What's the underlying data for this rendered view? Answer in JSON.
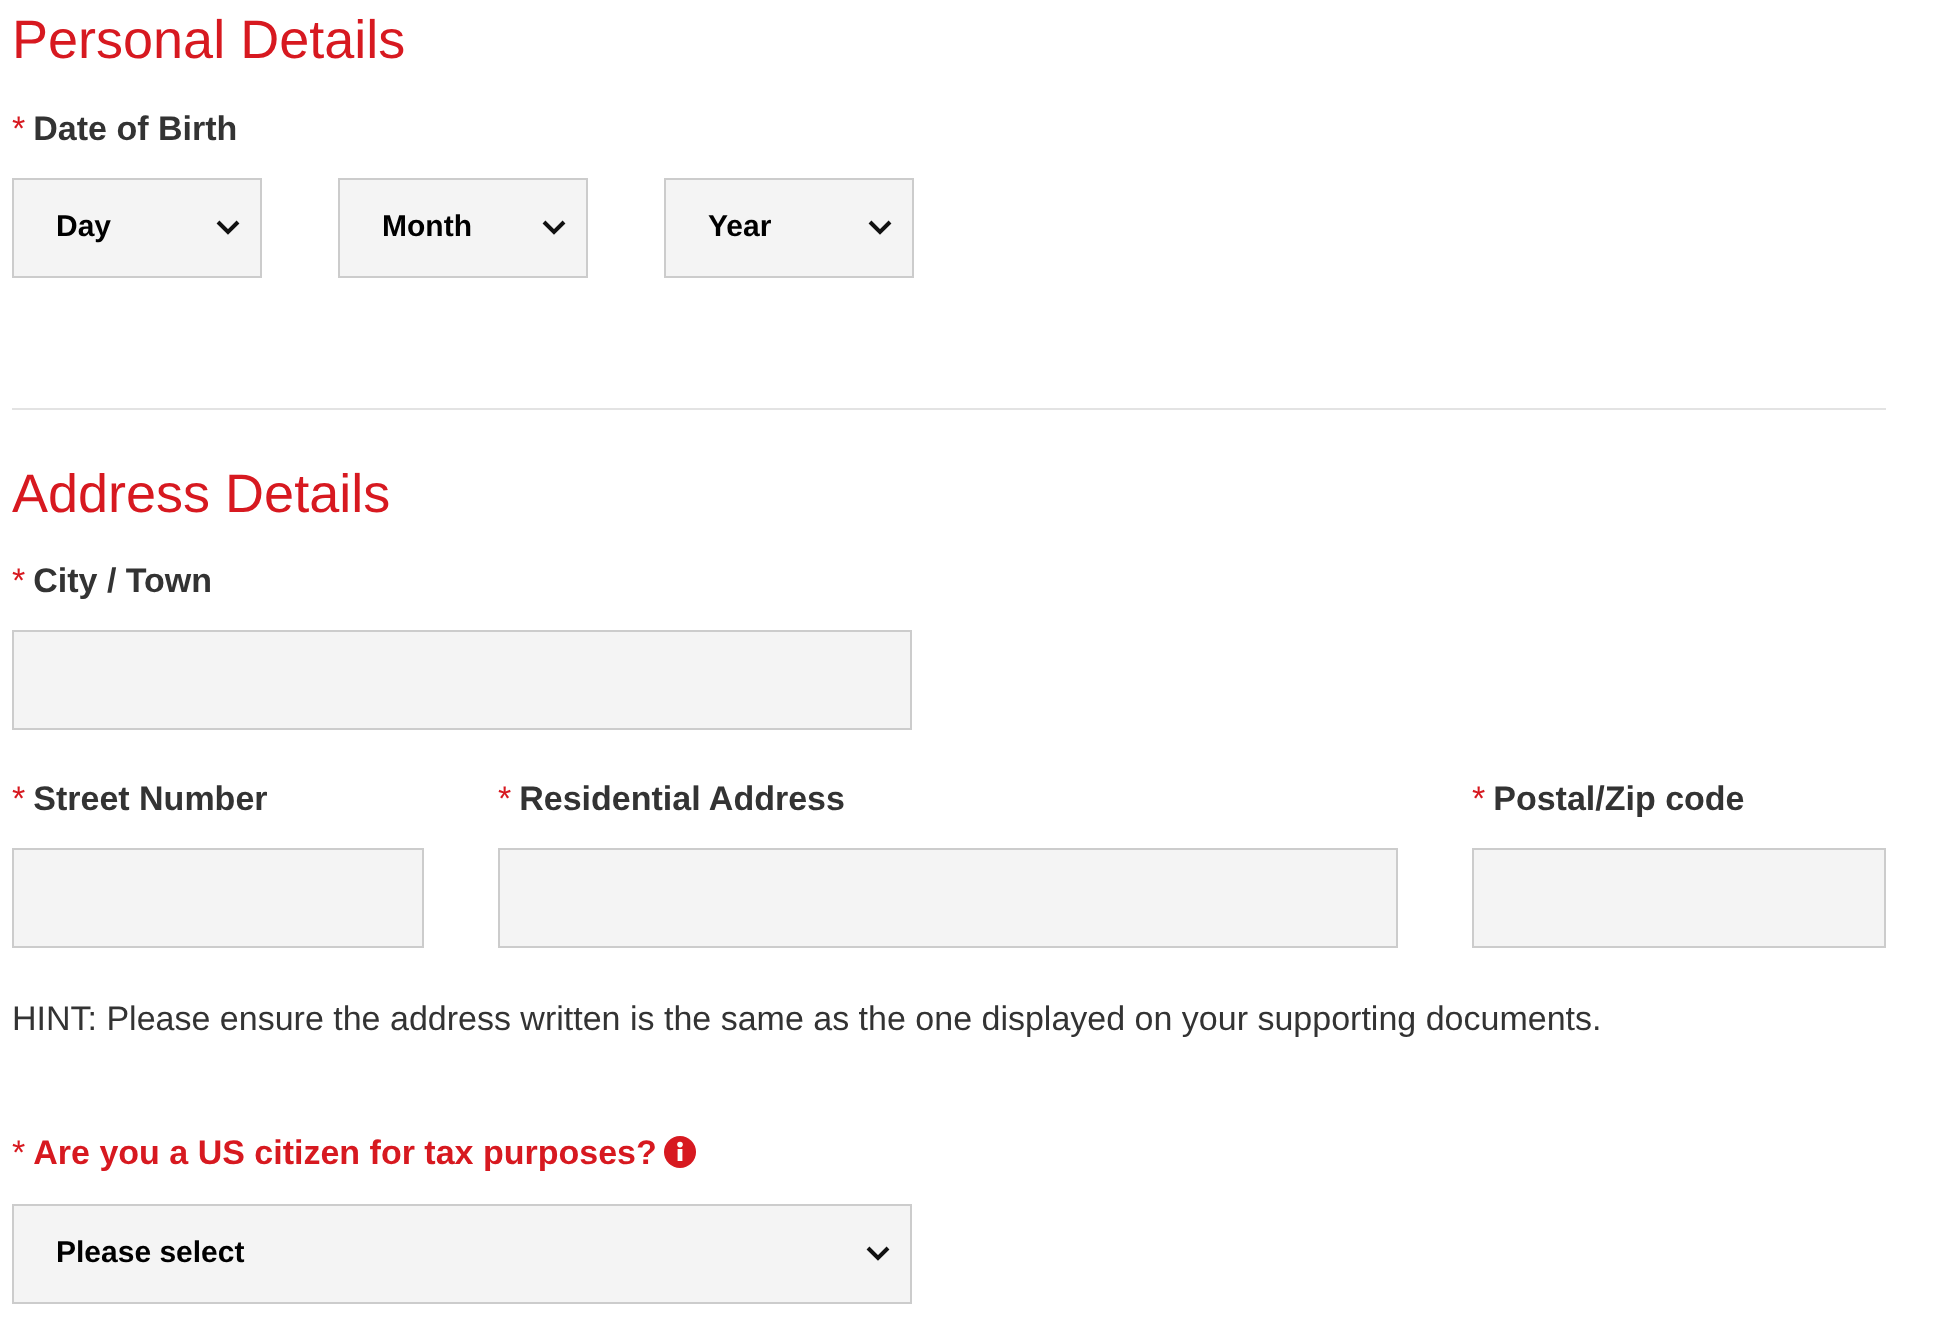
{
  "personal": {
    "heading": "Personal Details",
    "date_of_birth": {
      "required_mark": "*",
      "label": "Date of Birth",
      "selects": [
        {
          "value": "Day"
        },
        {
          "value": "Month"
        },
        {
          "value": "Year"
        }
      ]
    }
  },
  "address": {
    "heading": "Address Details",
    "city": {
      "required_mark": "*",
      "label": "City / Town"
    },
    "row": [
      {
        "required_mark": "*",
        "label": "Street Number"
      },
      {
        "required_mark": "*",
        "label": "Residential Address"
      },
      {
        "required_mark": "*",
        "label": "Postal/Zip code"
      }
    ],
    "hint": "HINT: Please ensure the address written is the same as the one displayed on your supporting documents.",
    "question": {
      "required_mark": "*",
      "label": "Are you a US citizen for tax purposes?",
      "emphasized": true,
      "select": {
        "value": "Please select"
      }
    }
  }
}
